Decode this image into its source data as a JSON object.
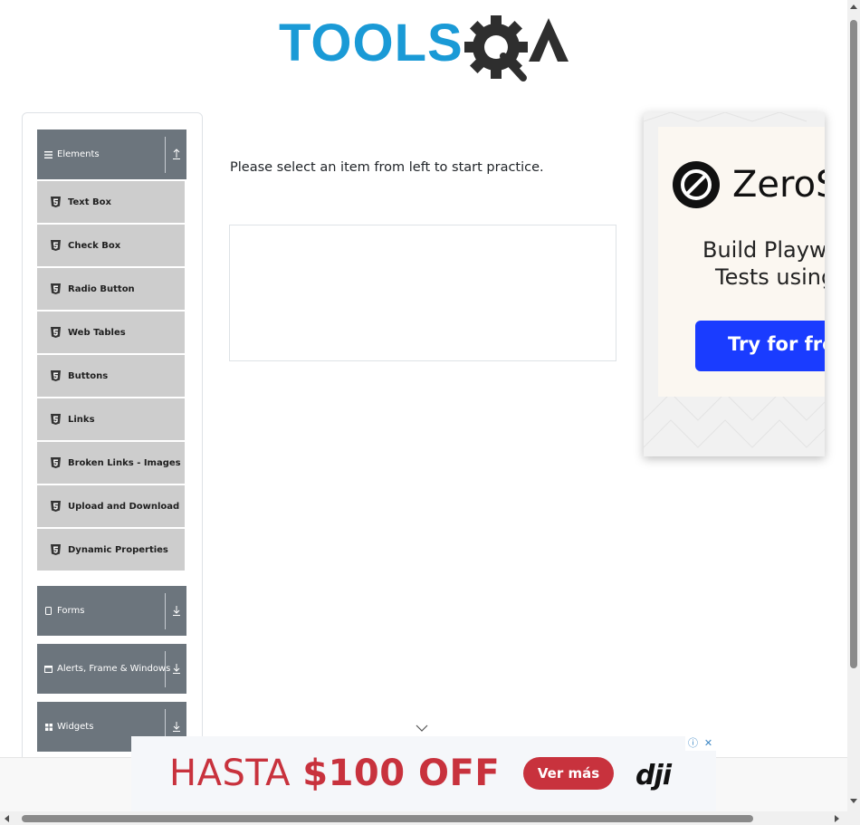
{
  "header": {
    "logo_text": "TOOLSQA",
    "colors": {
      "tools": "#1a9ad6",
      "qa": "#2e2e2e"
    }
  },
  "sidebar": {
    "groups": [
      {
        "label": "Elements",
        "icon": "hamburger-icon",
        "expanded": true,
        "arrow": "arrow-up-icon"
      },
      {
        "label": "Forms",
        "icon": "document-icon",
        "expanded": false,
        "arrow": "arrow-down-icon"
      },
      {
        "label": "Alerts, Frame & Windows",
        "icon": "window-icon",
        "expanded": false,
        "arrow": "arrow-down-icon"
      },
      {
        "label": "Widgets",
        "icon": "grid-icon",
        "expanded": false,
        "arrow": "arrow-down-icon"
      }
    ],
    "items": [
      {
        "label": "Text Box"
      },
      {
        "label": "Check Box"
      },
      {
        "label": "Radio Button"
      },
      {
        "label": "Web Tables"
      },
      {
        "label": "Buttons"
      },
      {
        "label": "Links"
      },
      {
        "label": "Broken Links - Images"
      },
      {
        "label": "Upload and Download"
      },
      {
        "label": "Dynamic Properties"
      }
    ],
    "colors": {
      "group_bg": "#6c757d",
      "item_bg": "#cdcdcd"
    }
  },
  "main": {
    "intro": "Please select an item from left to start practice."
  },
  "ad_right": {
    "brand": "ZeroSt",
    "line1": "Build Playwri",
    "line2": "Tests using",
    "button": "Try for free",
    "button_color": "#1a3cff"
  },
  "ad_bottom": {
    "text_plain": "HASTA ",
    "text_bold": "$100 OFF",
    "button": "Ver más",
    "logo": "dji",
    "info": "ⓘ",
    "close": "✕",
    "accent": "#c8323d"
  }
}
